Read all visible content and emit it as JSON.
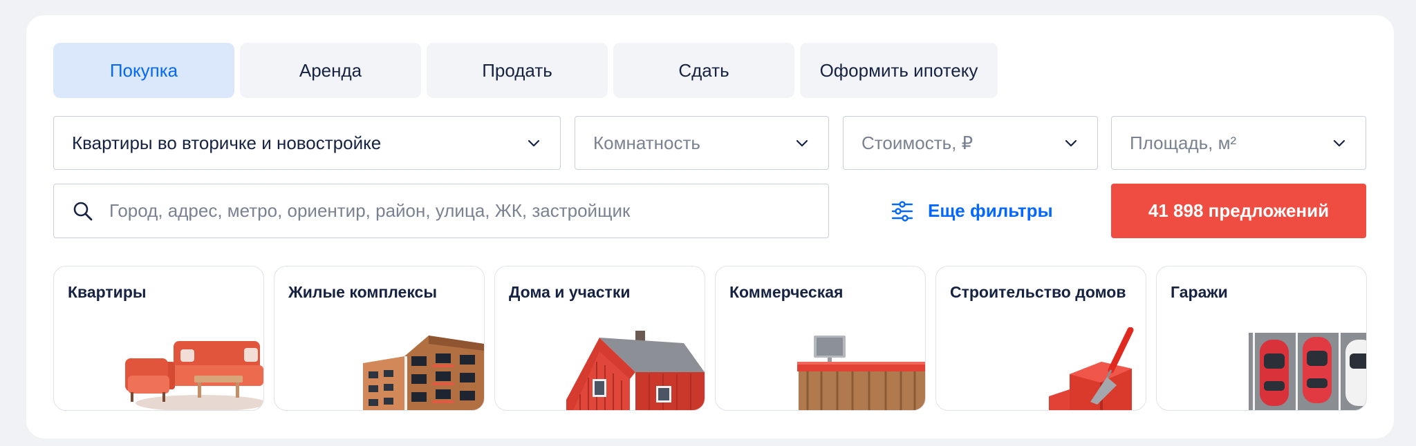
{
  "tabs": [
    {
      "label": "Покупка",
      "active": true
    },
    {
      "label": "Аренда",
      "active": false
    },
    {
      "label": "Продать",
      "active": false
    },
    {
      "label": "Сдать",
      "active": false
    },
    {
      "label": "Оформить ипотеку",
      "active": false
    }
  ],
  "filters": {
    "type": {
      "value": "Квартиры во вторичке и новостройке"
    },
    "rooms": {
      "placeholder": "Комнатность"
    },
    "price": {
      "placeholder": "Стоимость, ₽"
    },
    "area": {
      "placeholder": "Площадь, м²"
    }
  },
  "search": {
    "placeholder": "Город, адрес, метро, ориентир, район, улица, ЖК, застройщик",
    "icon": "search-icon"
  },
  "more_filters": {
    "label": "Еще фильтры",
    "icon": "sliders-icon"
  },
  "cta": {
    "label": "41 898 предложений"
  },
  "categories": [
    {
      "title": "Квартиры",
      "image": "sofa-image"
    },
    {
      "title": "Жилые комплексы",
      "image": "apartment-building-image"
    },
    {
      "title": "Дома и участки",
      "image": "house-image"
    },
    {
      "title": "Коммерческая",
      "image": "reception-desk-image"
    },
    {
      "title": "Строительство домов",
      "image": "brick-trowel-image"
    },
    {
      "title": "Гаражи",
      "image": "parked-cars-image"
    }
  ],
  "colors": {
    "accent": "#0468ff",
    "active_tab_bg": "#dbe8fc",
    "cta": "#ef4c42",
    "background": "#f1f2f6"
  }
}
